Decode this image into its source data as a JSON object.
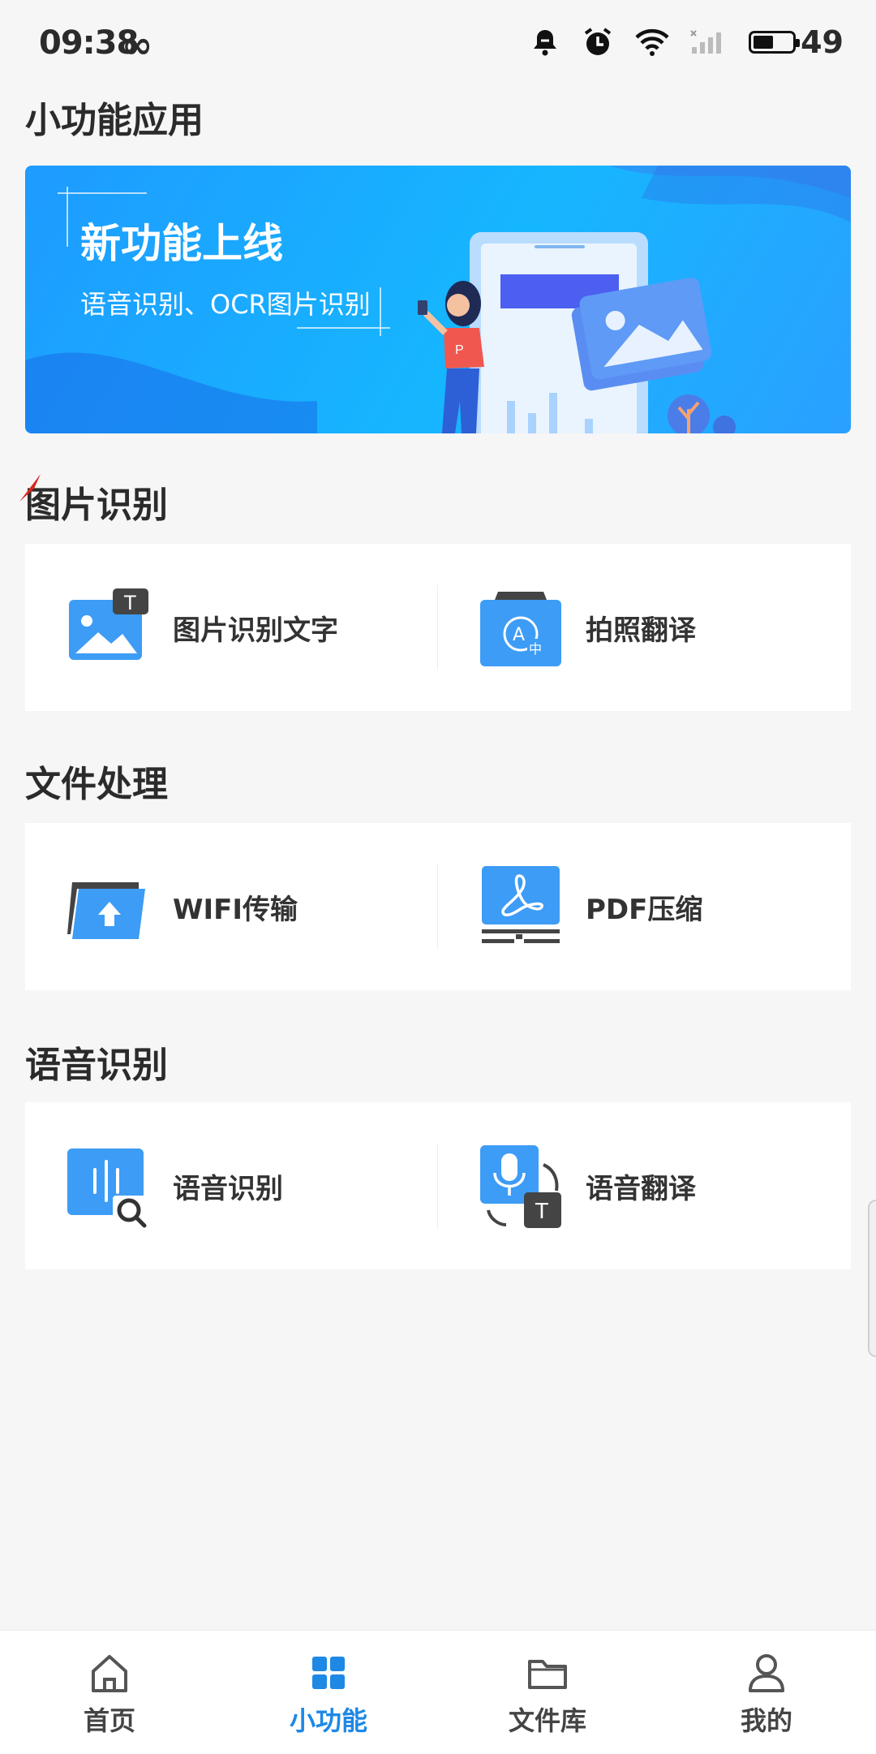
{
  "status_bar": {
    "time": "09:38",
    "infinity_symbol": "∞",
    "battery_level": "49",
    "icons": [
      "bell-muted-icon",
      "alarm-icon",
      "wifi-icon",
      "signal-icon",
      "battery-icon"
    ]
  },
  "page_title": "小功能应用",
  "banner": {
    "title": "新功能上线",
    "subtitle": "语音识别、OCR图片识别"
  },
  "sections": [
    {
      "title": "图片识别",
      "items": [
        {
          "label": "图片识别文字",
          "icon": "image-text-icon"
        },
        {
          "label": "拍照翻译",
          "icon": "photo-translate-icon"
        }
      ]
    },
    {
      "title": "文件处理",
      "items": [
        {
          "label": "WIFI传输",
          "icon": "wifi-upload-folder-icon"
        },
        {
          "label": "PDF压缩",
          "icon": "pdf-compress-icon"
        }
      ]
    },
    {
      "title": "语音识别",
      "items": [
        {
          "label": "语音识别",
          "icon": "voice-search-icon"
        },
        {
          "label": "语音翻译",
          "icon": "voice-translate-icon"
        }
      ]
    }
  ],
  "bottom_nav": [
    {
      "label": "首页",
      "icon": "home-icon",
      "active": false
    },
    {
      "label": "小功能",
      "icon": "grid-icon",
      "active": true
    },
    {
      "label": "文件库",
      "icon": "folder-icon",
      "active": false
    },
    {
      "label": "我的",
      "icon": "user-icon",
      "active": false
    }
  ],
  "colors": {
    "accent": "#1e88e5",
    "icon_blue": "#3d9cf5",
    "background": "#f6f6f6"
  }
}
